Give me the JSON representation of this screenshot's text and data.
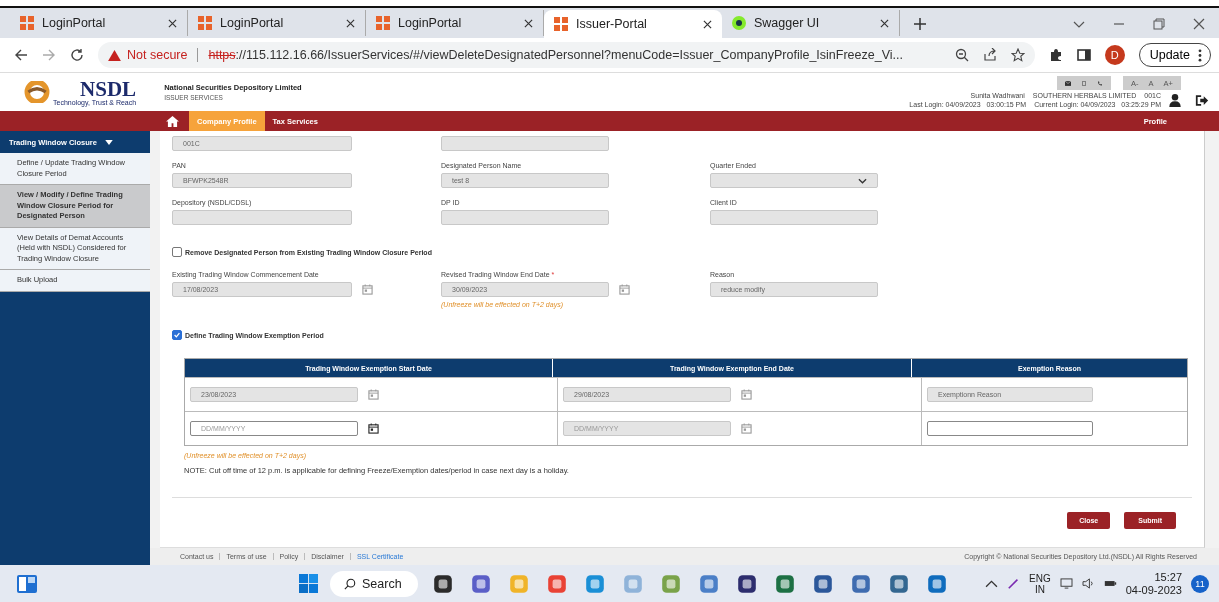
{
  "browser": {
    "tabs": [
      {
        "title": "LoginPortal",
        "kind": "portal",
        "selected": false
      },
      {
        "title": "LoginPortal",
        "kind": "portal",
        "selected": false
      },
      {
        "title": "LoginPortal",
        "kind": "portal",
        "selected": false
      },
      {
        "title": "Issuer-Portal",
        "kind": "portal",
        "selected": true
      },
      {
        "title": "Swagger UI",
        "kind": "swagger",
        "selected": false
      }
    ],
    "address": {
      "security": "Not secure",
      "scheme": "https",
      "rest": "://115.112.16.66/IssuerServices/#/viewDeleteDesignatedPersonnel?menuCode=Issuer_CompanyProfile_IsinFreeze_Vi..."
    },
    "profile_initial": "D",
    "update_button": "Update"
  },
  "header": {
    "logo": "NSDL",
    "tagline": "Technology, Trust & Reach",
    "org": "National Securities Depository Limited",
    "service": "ISSUER SERVICES",
    "font_buttons": [
      "A-",
      "A",
      "A+"
    ],
    "user": {
      "name": "Sunita Wadhwani",
      "company": "SOUTHERN HERBALS LIMITED",
      "code": "001C",
      "last_login": "Last Login: 04/09/2023   03:00:15 PM",
      "current_login": "Current Login: 04/09/2023   03:25:29 PM"
    }
  },
  "nav": {
    "items": [
      {
        "label": "Company Profile",
        "selected": true
      },
      {
        "label": "Tax Services",
        "selected": false
      }
    ],
    "right": "Profile"
  },
  "sidebar": {
    "heading": "Trading Window Closure",
    "items": [
      {
        "label": "Define / Update Trading Window Closure Period",
        "selected": false
      },
      {
        "label": "View / Modify / Define Trading Window Closure Period for Designated Person",
        "selected": true
      },
      {
        "label": "View Details of Demat Accounts (Held with NSDL) Considered for Trading Window Closure",
        "selected": false
      },
      {
        "label": "Bulk Upload",
        "selected": false
      }
    ]
  },
  "form": {
    "rows": [
      {
        "kind": "fields",
        "fields": [
          {
            "kind": "text",
            "value": "001C",
            "disabled": true
          },
          {
            "kind": "text",
            "disabled": true
          }
        ]
      },
      {
        "kind": "fields",
        "fields": [
          {
            "label": "PAN",
            "kind": "text",
            "value": "BFWPK2548R",
            "disabled": true
          },
          {
            "label": "Designated Person Name",
            "kind": "text",
            "value": "test 8",
            "disabled": true
          },
          {
            "label": "Quarter Ended",
            "kind": "select",
            "disabled": true
          }
        ]
      },
      {
        "kind": "fields",
        "fields": [
          {
            "label": "Depository (NSDL/CDSL)",
            "kind": "text",
            "disabled": true
          },
          {
            "label": "DP ID",
            "kind": "text",
            "disabled": true
          },
          {
            "label": "Client ID",
            "kind": "text",
            "disabled": true
          }
        ]
      },
      {
        "kind": "checkbox",
        "label": "Remove Designated Person from Existing Trading Window Closure Period",
        "checked": false
      },
      {
        "kind": "fields",
        "fields": [
          {
            "label": "Existing Trading Window Commencement Date",
            "kind": "date",
            "value": "17/08/2023",
            "disabled": true
          },
          {
            "label": "Revised Trading Window End Date",
            "required_mark": "*",
            "kind": "date",
            "value": "30/09/2023",
            "disabled": true,
            "hint": "(Unfreeze will be effected on T+2 days)"
          },
          {
            "label": "Reason",
            "kind": "text",
            "value": "reduce modify",
            "disabled": true
          }
        ]
      },
      {
        "kind": "checkbox",
        "label": "Define Trading Window Exemption Period",
        "checked": true
      }
    ],
    "table": {
      "columns": [
        "Trading Window Exemption Start Date",
        "Trading Window Exemption End Date",
        "Exemption Reason"
      ],
      "rows": [
        [
          {
            "kind": "date",
            "value": "23/08/2023",
            "disabled": true
          },
          {
            "kind": "date",
            "value": "29/08/2023",
            "disabled": true
          },
          {
            "kind": "text",
            "value": "Exemptionn Reason",
            "disabled": true
          }
        ],
        [
          {
            "kind": "date",
            "placeholder": "DD/MM/YYYY",
            "disabled": false
          },
          {
            "kind": "date",
            "placeholder": "DD/MM/YYYY",
            "disabled": true
          },
          {
            "kind": "text",
            "disabled": false
          }
        ]
      ]
    },
    "hint": "(Unfreeze will be effected on T+2 days)",
    "note": "NOTE: Cut off time of 12 p.m. is applicable for defining Freeze/Exemption dates/period in case next day is a holiday.",
    "buttons": [
      "Close",
      "Submit"
    ]
  },
  "footer": {
    "links": [
      "Contact us",
      "Terms of use",
      "Policy",
      "Disclaimer"
    ],
    "ssl": "SSL Certificate",
    "copyright": "Copyright © National Securities Depository Ltd.(NSDL) All Rights Reserved"
  },
  "taskbar": {
    "search": "Search",
    "lang": "ENG",
    "region": "IN",
    "time": "15:27",
    "date": "04-09-2023",
    "badge": "11"
  }
}
